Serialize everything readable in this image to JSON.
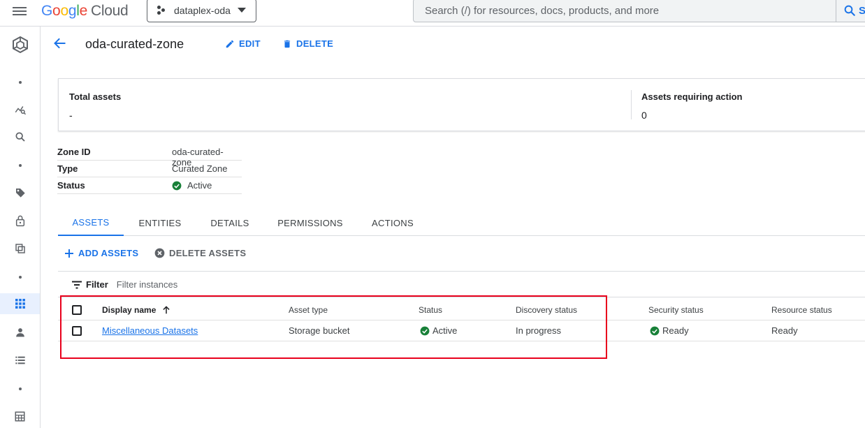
{
  "topbar": {
    "logo_google": [
      "G",
      "o",
      "o",
      "g",
      "l",
      "e"
    ],
    "logo_cloud": "Cloud",
    "project_name": "dataplex-oda",
    "search_placeholder": "Search (/) for resources, docs, products, and more",
    "search_button_label": "S"
  },
  "header": {
    "title": "oda-curated-zone",
    "edit_label": "EDIT",
    "delete_label": "DELETE"
  },
  "summary": {
    "total_assets_label": "Total assets",
    "total_assets_value": "-",
    "requiring_action_label": "Assets requiring action",
    "requiring_action_value": "0"
  },
  "zone_info": [
    {
      "key": "Zone ID",
      "value": "oda-curated-zone"
    },
    {
      "key": "Type",
      "value": "Curated Zone"
    },
    {
      "key": "Status",
      "value": "Active"
    }
  ],
  "tabs": [
    "ASSETS",
    "ENTITIES",
    "DETAILS",
    "PERMISSIONS",
    "ACTIONS"
  ],
  "active_tab": "ASSETS",
  "actions": {
    "add_assets": "ADD ASSETS",
    "delete_assets": "DELETE ASSETS"
  },
  "filter": {
    "label": "Filter",
    "placeholder": "Filter instances"
  },
  "table": {
    "columns": [
      "Display name",
      "Asset type",
      "Status",
      "Discovery status",
      "Security status",
      "Resource status"
    ],
    "sort_column": "Display name",
    "rows": [
      {
        "display_name": "Miscellaneous Datasets",
        "asset_type": "Storage bucket",
        "status": "Active",
        "discovery_status": "In progress",
        "security_status": "Ready",
        "resource_status": "Ready"
      }
    ]
  },
  "colors": {
    "accent": "#1a73e8",
    "success": "#188038",
    "highlight": "#e8001c"
  },
  "icons": {
    "rail": [
      "dataplex-logo-icon",
      "dot-icon",
      "analytics-icon",
      "search-icon",
      "dot-icon",
      "tag-icon",
      "lock-icon",
      "copy-icon",
      "dot-icon",
      "grid-icon",
      "person-icon",
      "list-icon",
      "dot-icon",
      "table-icon"
    ]
  }
}
